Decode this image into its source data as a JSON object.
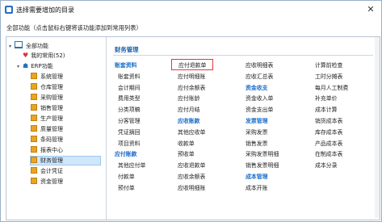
{
  "window": {
    "title": "选择需要增加的目录",
    "close_glyph": "✕"
  },
  "hint": "全部功能（点击鼠标右键将该功能添加到常用列表）",
  "tree": {
    "all": "全部功能",
    "common": "我的常用(52)",
    "erp": "ERP功能",
    "modules": [
      "系统管理",
      "仓库管理",
      "采购管理",
      "销售管理",
      "生产管理",
      "质量管理",
      "条码管理",
      "报表中心",
      "财务管理",
      "会计凭证",
      "资金管理"
    ],
    "selected": "财务管理"
  },
  "panel": {
    "title": "财务管理",
    "col1": [
      {
        "t": "账套资料",
        "cat": true
      },
      {
        "t": "账套资料"
      },
      {
        "t": "会计期间"
      },
      {
        "t": "费用类型"
      },
      {
        "t": "分类项稿"
      },
      {
        "t": "分客管理"
      },
      {
        "t": "凭证摘回"
      },
      {
        "t": "项目资料"
      },
      {
        "t": "应付账款",
        "cat": true
      },
      {
        "t": "其他应付单"
      },
      {
        "t": "付款单"
      },
      {
        "t": "预付单"
      }
    ],
    "col2": [
      {
        "t": "应付退款单",
        "highlight": true
      },
      {
        "t": "应付明细账"
      },
      {
        "t": "应付余额表"
      },
      {
        "t": "应付账龄"
      },
      {
        "t": "应付月结"
      },
      {
        "t": "应收账款",
        "cat": true
      },
      {
        "t": "其他应收单"
      },
      {
        "t": "收款单"
      },
      {
        "t": "预收单"
      },
      {
        "t": "应收退款单"
      },
      {
        "t": "应收余额表"
      },
      {
        "t": "应收明细账"
      }
    ],
    "col3": [
      {
        "t": "应收明细表"
      },
      {
        "t": "应收汇总表"
      },
      {
        "t": "资金收支",
        "cat": true
      },
      {
        "t": "资金收入单"
      },
      {
        "t": "资金支出单"
      },
      {
        "t": "发票管理",
        "cat": true
      },
      {
        "t": "采购发票"
      },
      {
        "t": "销售发票"
      },
      {
        "t": "采购发票明细"
      },
      {
        "t": "销售发票明细"
      },
      {
        "t": "成本管理",
        "cat": true
      },
      {
        "t": "成本开账"
      }
    ],
    "col4": [
      {
        "t": "计算前检查"
      },
      {
        "t": "工时分摊表"
      },
      {
        "t": "每月人工制费"
      },
      {
        "t": "补充单价"
      },
      {
        "t": "成本计算"
      },
      {
        "t": "销货成本表"
      },
      {
        "t": "库存成本表"
      },
      {
        "t": "产品成本表"
      },
      {
        "t": "在制成本表"
      },
      {
        "t": "成本分录"
      }
    ]
  }
}
